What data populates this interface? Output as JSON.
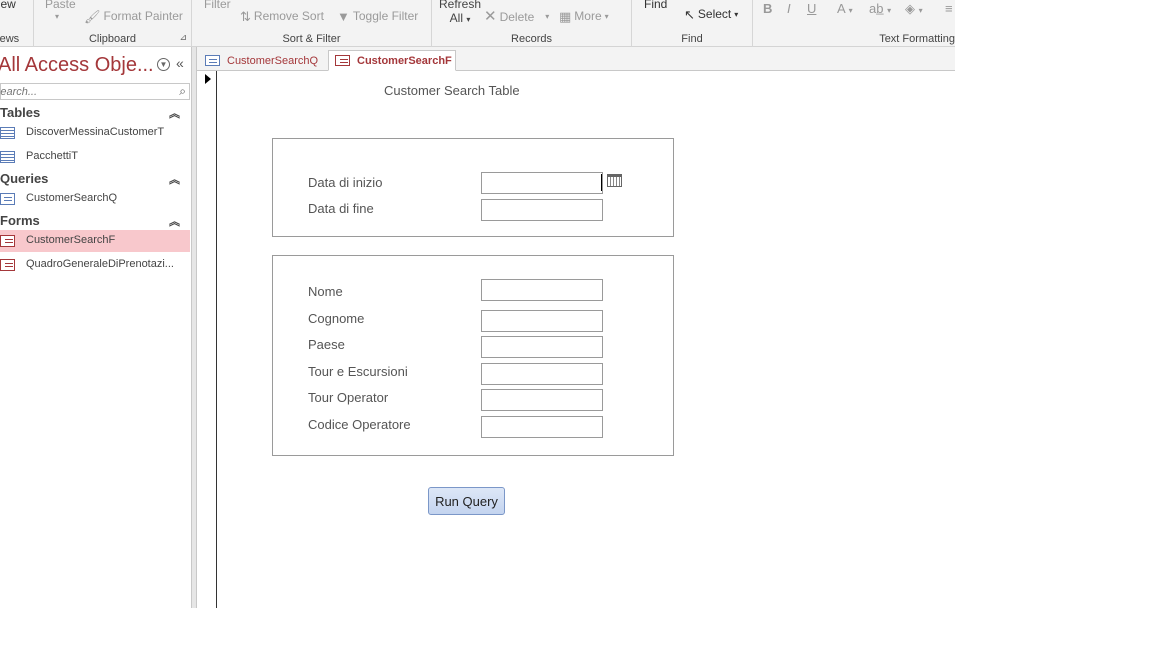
{
  "ribbon": {
    "views": {
      "view_label": "View",
      "group": "Views"
    },
    "clipboard": {
      "paste_label": "Paste",
      "format_painter_label": "Format Painter",
      "group": "Clipboard"
    },
    "sort_filter": {
      "filter_label": "Filter",
      "remove_sort_label": "Remove Sort",
      "toggle_filter_label": "Toggle Filter",
      "group": "Sort & Filter"
    },
    "records": {
      "refresh_label": "Refresh",
      "refresh_sub": "All",
      "delete_label": "Delete",
      "more_label": "More",
      "group": "Records"
    },
    "find": {
      "find_label": "Find",
      "select_label": "Select",
      "group": "Find"
    },
    "text_formatting": {
      "group": "Text Formatting",
      "bold": "B",
      "italic": "I",
      "underline": "U",
      "font_color": "A"
    }
  },
  "nav": {
    "title": "All Access Obje...",
    "search_placeholder": "Search...",
    "categories": [
      {
        "label": "Tables",
        "items": [
          "DiscoverMessinaCustomerT",
          "PacchettiT"
        ]
      },
      {
        "label": "Queries",
        "items": [
          "CustomerSearchQ"
        ]
      },
      {
        "label": "Forms",
        "items": [
          "CustomerSearchF",
          "QuadroGeneraleDiPrenotazi..."
        ]
      }
    ]
  },
  "tabs": [
    {
      "label": "CustomerSearchQ",
      "active": false
    },
    {
      "label": "CustomerSearchF",
      "active": true
    }
  ],
  "form": {
    "title": "Customer Search Table",
    "date_fields": [
      {
        "label": "Data di inizio",
        "value": ""
      },
      {
        "label": "Data di fine",
        "value": ""
      }
    ],
    "text_fields": [
      {
        "label": "Nome",
        "value": ""
      },
      {
        "label": "Cognome",
        "value": ""
      },
      {
        "label": "Paese",
        "value": ""
      },
      {
        "label": "Tour e Escursioni",
        "value": ""
      },
      {
        "label": "Tour Operator",
        "value": ""
      },
      {
        "label": "Codice Operatore",
        "value": ""
      }
    ],
    "run_button": "Run Query"
  },
  "colors": {
    "access_accent": "#a4373a",
    "selected_item_bg": "#f8c8cc",
    "ribbon_bg": "#f3f3f3",
    "button_bg": "#c4d4ef"
  },
  "icons": [
    "calendar-icon",
    "search-icon",
    "format-painter-icon",
    "remove-sort-icon",
    "toggle-filter-icon",
    "delete-icon",
    "more-icon",
    "cursor-icon"
  ]
}
